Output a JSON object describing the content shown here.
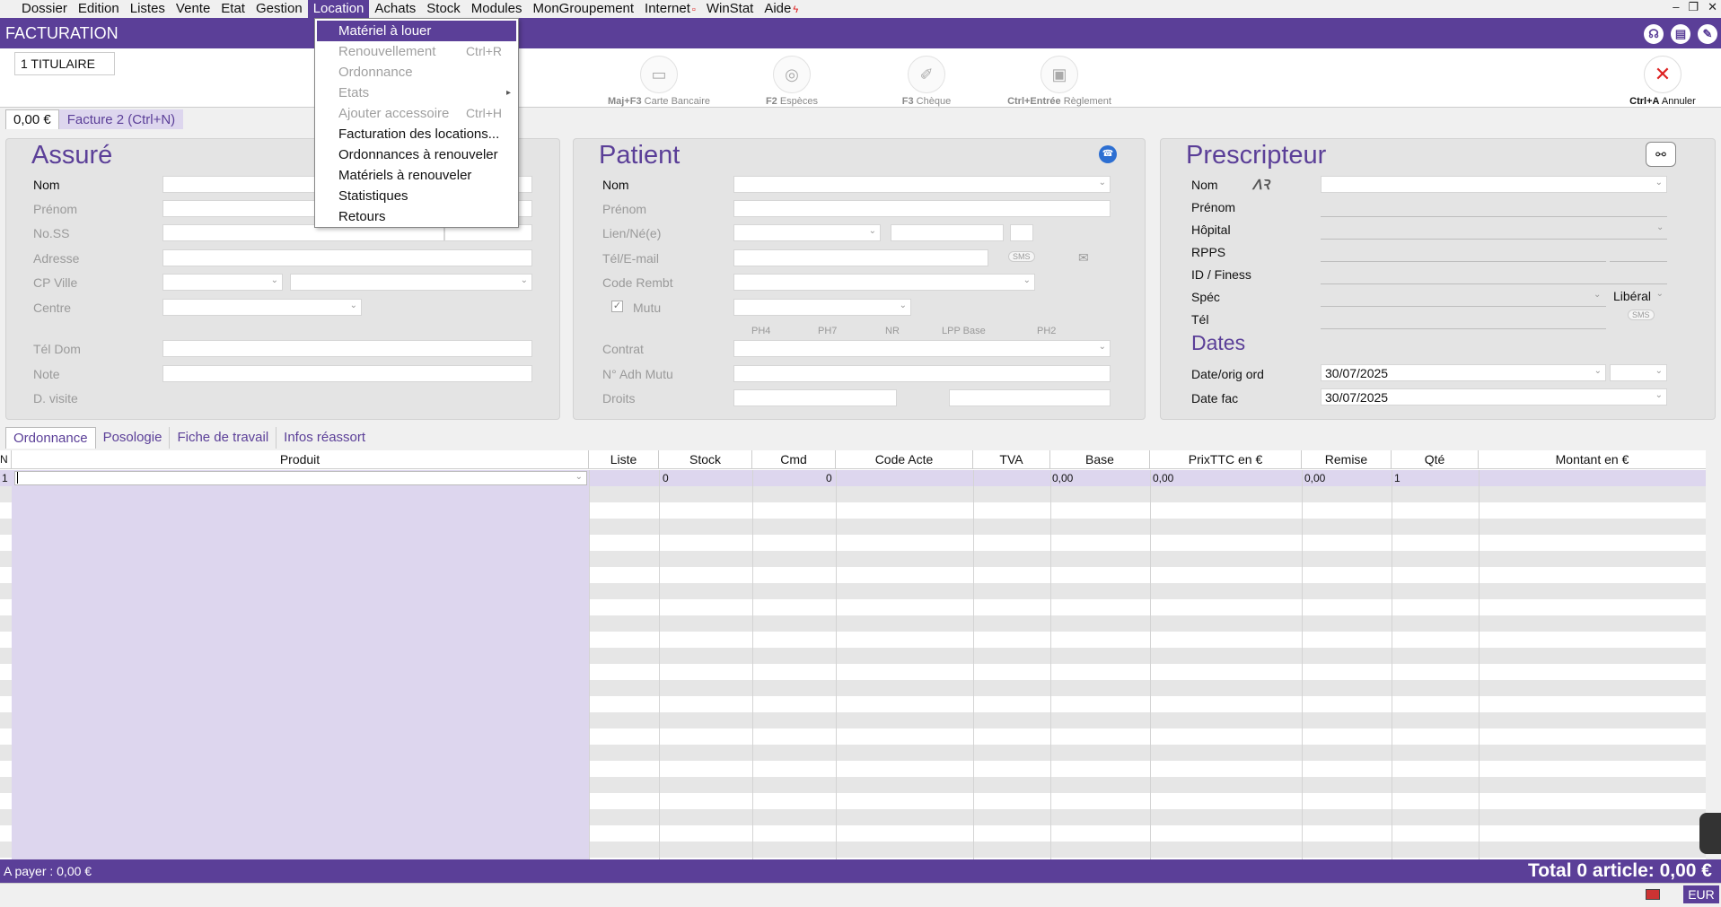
{
  "menubar": {
    "items": [
      {
        "label": "Dossier"
      },
      {
        "label": "Edition"
      },
      {
        "label": "Listes"
      },
      {
        "label": "Vente"
      },
      {
        "label": "Etat"
      },
      {
        "label": "Gestion"
      },
      {
        "label": "Location"
      },
      {
        "label": "Achats"
      },
      {
        "label": "Stock"
      },
      {
        "label": "Modules"
      },
      {
        "label": "MonGroupement"
      },
      {
        "label": "Internet"
      },
      {
        "label": "WinStat"
      },
      {
        "label": "Aide"
      }
    ],
    "active": "Location"
  },
  "window": {
    "title": "FACTURATION"
  },
  "toolbar": {
    "titulaire": "1 TITULAIRE",
    "cb": {
      "key": "Maj+F3",
      "label": "Carte Bancaire"
    },
    "especes": {
      "key": "F2",
      "label": "Espèces"
    },
    "cheque": {
      "key": "F3",
      "label": "Chèque"
    },
    "reglement": {
      "key": "Ctrl+Entrée",
      "label": "Règlement"
    },
    "annuler": {
      "key": "Ctrl+A",
      "label": "Annuler"
    }
  },
  "invoice_tabs": {
    "first": "0,00 €",
    "second": "Facture 2 (Ctrl+N)"
  },
  "dropdown": {
    "items": [
      {
        "label": "Matériel à louer",
        "state": "selected",
        "shortcut": ""
      },
      {
        "label": "Renouvellement",
        "state": "disabled",
        "shortcut": "Ctrl+R"
      },
      {
        "label": "Ordonnance",
        "state": "disabled",
        "shortcut": ""
      },
      {
        "label": "Etats",
        "state": "disabled",
        "shortcut": ""
      },
      {
        "label": "Ajouter accessoire",
        "state": "disabled",
        "shortcut": "Ctrl+H"
      },
      {
        "label": "Facturation des locations...",
        "state": "enabled",
        "shortcut": ""
      },
      {
        "label": "Ordonnances à renouveler",
        "state": "enabled",
        "shortcut": ""
      },
      {
        "label": "Matériels à renouveler",
        "state": "enabled",
        "shortcut": ""
      },
      {
        "label": "Statistiques",
        "state": "enabled",
        "shortcut": ""
      },
      {
        "label": "Retours",
        "state": "enabled",
        "shortcut": ""
      }
    ]
  },
  "assure": {
    "title": "Assuré",
    "labels": {
      "nom": "Nom",
      "prenom": "Prénom",
      "noss": "No.SS",
      "adresse": "Adresse",
      "cpville": "CP Ville",
      "centre": "Centre",
      "teldom": "Tél Dom",
      "note": "Note",
      "dvisite": "D. visite"
    }
  },
  "patient": {
    "title": "Patient",
    "labels": {
      "nom": "Nom",
      "prenom": "Prénom",
      "lien": "Lien/Né(e)",
      "tel": "Tél/E-mail",
      "coderembt": "Code Rembt",
      "mutu": "Mutu",
      "contrat": "Contrat",
      "adhmutu": "N° Adh Mutu",
      "droits": "Droits"
    },
    "sms": "SMS",
    "ph": [
      "PH4",
      "PH7",
      "NR",
      "LPP Base",
      "PH2"
    ]
  },
  "prescripteur": {
    "title": "Prescripteur",
    "labels": {
      "nom": "Nom",
      "prenom": "Prénom",
      "hopital": "Hôpital",
      "rpps": "RPPS",
      "idfiness": "ID / Finess",
      "spec": "Spéc",
      "tel": "Tél"
    },
    "spec_value": "Libéral",
    "sms": "SMS"
  },
  "dates": {
    "title": "Dates",
    "orig_label": "Date/orig ord",
    "orig_value": "30/07/2025",
    "fac_label": "Date fac",
    "fac_value": "30/07/2025"
  },
  "lower_tabs": [
    "Ordonnance",
    "Posologie",
    "Fiche de travail",
    "Infos réassort"
  ],
  "grid": {
    "headers": [
      "N",
      "Produit",
      "Liste",
      "Stock",
      "Cmd",
      "Code Acte",
      "TVA",
      "Base",
      "PrixTTC en €",
      "Remise",
      "Qté",
      "Montant en €"
    ],
    "row1": {
      "n": "1",
      "stock": "0",
      "cmd": "0",
      "base": "0,00",
      "prix": "0,00",
      "remise": "0,00",
      "qte": "1"
    }
  },
  "footer": {
    "a_payer": "A payer :  0,00 €",
    "total": "Total 0 article:  0,00 €"
  },
  "status": {
    "currency": "EUR"
  }
}
